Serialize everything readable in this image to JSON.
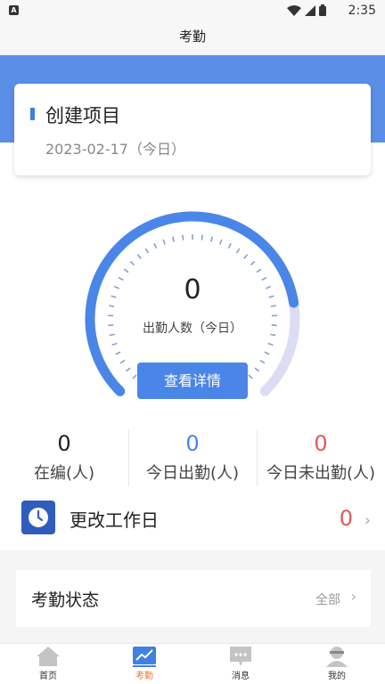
{
  "status_bar": {
    "time": "2:35",
    "app_badge": "A"
  },
  "header": {
    "title": "考勤"
  },
  "project_card": {
    "name": "创建项目",
    "date": "2023-02-17（今日）"
  },
  "gauge": {
    "count": "0",
    "label": "出勤人数（今日）",
    "button_label": "查看详情",
    "fill_fraction": 0.8
  },
  "stats": [
    {
      "value": "0",
      "label": "在编(人)",
      "color": "#222222"
    },
    {
      "value": "0",
      "label": "今日出勤(人)",
      "color": "#4a86e8"
    },
    {
      "value": "0",
      "label": "今日未出勤(人)",
      "color": "#e05a5a"
    }
  ],
  "workday": {
    "label": "更改工作日",
    "count": "0",
    "icon": "clock-icon"
  },
  "attendance_status": {
    "title": "考勤状态",
    "filter_label": "全部"
  },
  "tabbar": {
    "items": [
      {
        "label": "首页",
        "icon": "home-icon",
        "active": false
      },
      {
        "label": "考勤",
        "icon": "chart-icon",
        "active": true
      },
      {
        "label": "消息",
        "icon": "message-icon",
        "active": false
      },
      {
        "label": "我的",
        "icon": "user-icon",
        "active": false
      }
    ]
  },
  "colors": {
    "primary": "#4a86e8",
    "accent_orange": "#e8762f",
    "alert_red": "#e05a5a",
    "gauge_track": "#dcdcf4"
  }
}
